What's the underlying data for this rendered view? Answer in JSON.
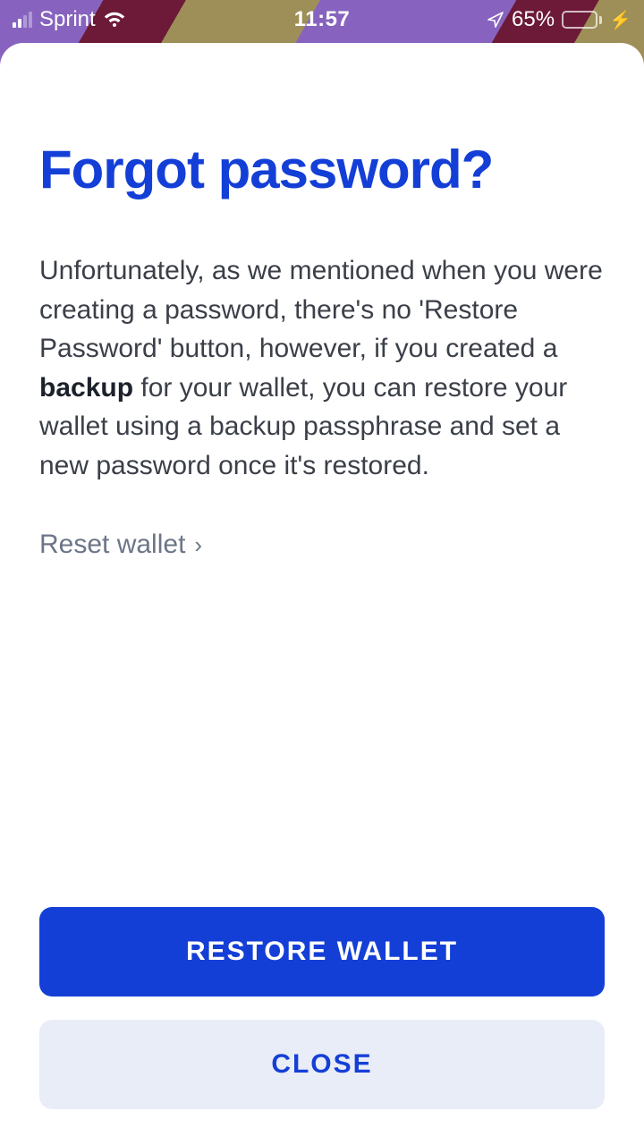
{
  "status_bar": {
    "carrier": "Sprint",
    "time": "11:57",
    "battery_pct": "65%"
  },
  "modal": {
    "title": "Forgot password?",
    "body_prefix": "Unfortunately, as we mentioned when you were creating a password, there's no 'Restore Password' button, however, if you created a ",
    "body_bold": "backup",
    "body_suffix": " for your wallet, you can restore your wallet using a backup passphrase and set a new password once it's restored.",
    "reset_link": "Reset wallet",
    "restore_btn": "RESTORE WALLET",
    "close_btn": "CLOSE"
  }
}
